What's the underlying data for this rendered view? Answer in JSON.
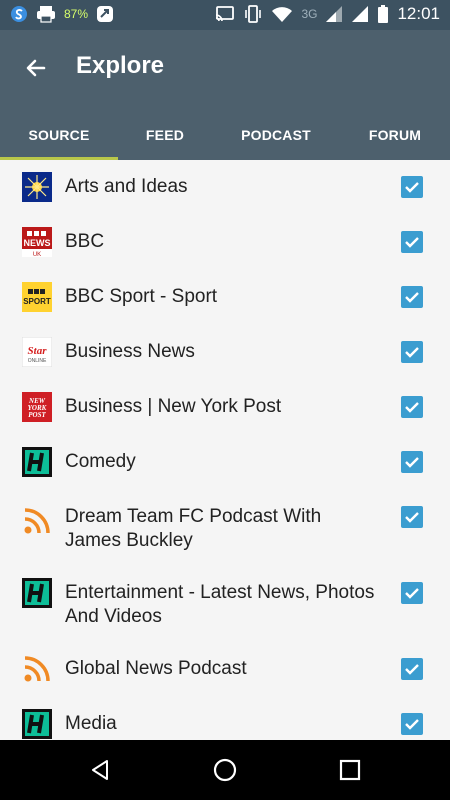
{
  "status_bar": {
    "battery_percent": "87%",
    "network": "3G",
    "time": "12:01",
    "icons": [
      "s-app-icon",
      "printer-icon",
      "battery-small-icon",
      "notification-app-icon",
      "cast-icon",
      "vibrate-icon",
      "wifi-icon",
      "signal-icon",
      "signal-icon",
      "battery-icon"
    ]
  },
  "app_bar": {
    "title": "Explore",
    "background": "#4d606d",
    "accent": "#b9c74a"
  },
  "tabs": [
    {
      "label": "SOURCE",
      "active": true
    },
    {
      "label": "FEED",
      "active": false
    },
    {
      "label": "PODCAST",
      "active": false
    },
    {
      "label": "FORUM",
      "active": false
    }
  ],
  "sources": [
    {
      "label": "Arts and Ideas",
      "icon": "arts-ideas-icon",
      "checked": true
    },
    {
      "label": "BBC",
      "icon": "bbc-news-icon",
      "checked": true
    },
    {
      "label": "BBC Sport - Sport",
      "icon": "bbc-sport-icon",
      "checked": true
    },
    {
      "label": "Business News",
      "icon": "star-online-icon",
      "checked": true
    },
    {
      "label": "Business | New York Post",
      "icon": "new-york-post-icon",
      "checked": true
    },
    {
      "label": "Comedy",
      "icon": "huffpost-icon",
      "checked": true
    },
    {
      "label": "Dream Team FC Podcast With James Buckley",
      "icon": "rss-icon",
      "checked": true
    },
    {
      "label": "Entertainment - Latest News, Photos And Videos",
      "icon": "huffpost-icon",
      "checked": true
    },
    {
      "label": "Global News Podcast",
      "icon": "rss-icon",
      "checked": true
    },
    {
      "label": "Media",
      "icon": "huffpost-icon",
      "checked": true
    }
  ],
  "checkbox_color": "#3b9dd0",
  "nav": [
    "back-icon",
    "home-icon",
    "recents-icon"
  ]
}
